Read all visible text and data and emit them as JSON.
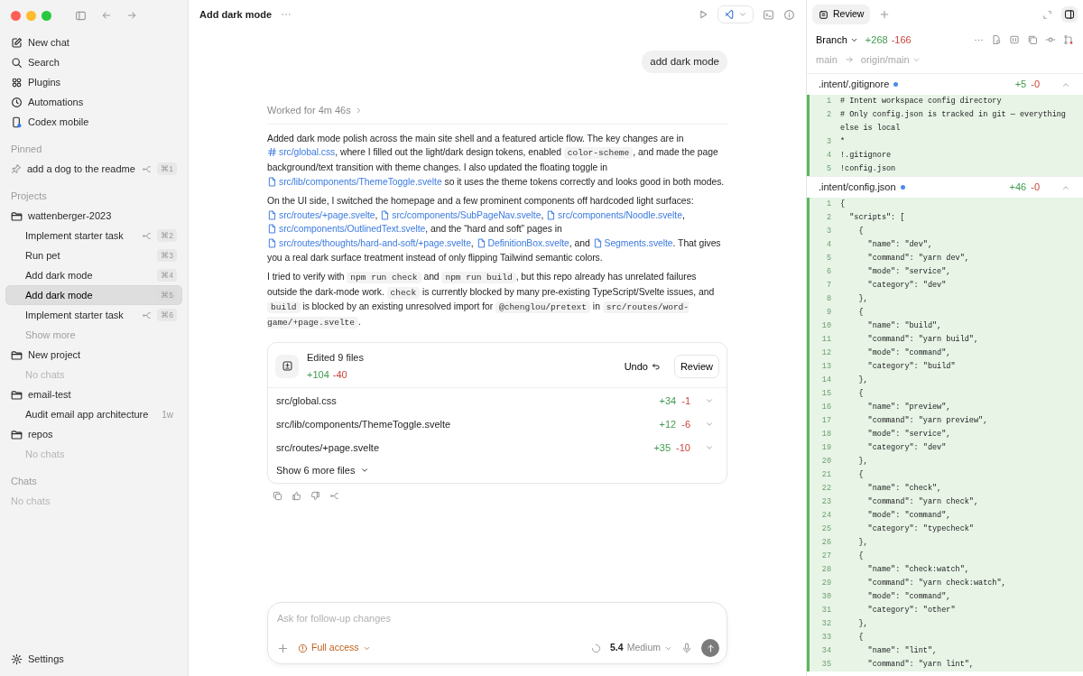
{
  "sidebar": {
    "nav": [
      {
        "label": "New chat"
      },
      {
        "label": "Search"
      },
      {
        "label": "Plugins"
      },
      {
        "label": "Automations"
      },
      {
        "label": "Codex mobile"
      }
    ],
    "pinned": {
      "heading": "Pinned",
      "chats": [
        {
          "title": "add a dog to the readme",
          "shortcut": "⌘1",
          "forked": true,
          "selected": false
        }
      ]
    },
    "projects": {
      "heading": "Projects",
      "items": [
        {
          "name": "wattenberger-2023",
          "chats": [
            {
              "title": "Implement starter task",
              "shortcut": "⌘2",
              "forked": true,
              "selected": false
            },
            {
              "title": "Run pet",
              "shortcut": "⌘3",
              "forked": false,
              "selected": false
            },
            {
              "title": "Add dark mode",
              "shortcut": "⌘4",
              "forked": false,
              "selected": false
            },
            {
              "title": "Add dark mode",
              "shortcut": "⌘5",
              "forked": false,
              "selected": true
            },
            {
              "title": "Implement starter task",
              "shortcut": "⌘6",
              "forked": true,
              "selected": false
            }
          ],
          "show_more": "Show more"
        },
        {
          "name": "New project",
          "empty_text": "No chats"
        },
        {
          "name": "email-test",
          "chats": [
            {
              "title": "Audit email app architecture",
              "age": "1w",
              "forked": false,
              "selected": false
            }
          ]
        },
        {
          "name": "repos",
          "empty_text": "No chats"
        }
      ]
    },
    "chats": {
      "heading": "Chats",
      "empty_text": "No chats"
    },
    "settings": "Settings"
  },
  "header": {
    "title": "Add dark mode"
  },
  "user_message": "add dark mode",
  "worked_for": "Worked for 4m 46s",
  "paragraphs": [
    [
      {
        "kind": "text",
        "text": "Added dark mode polish across the main site shell and a featured article flow. The key changes are in "
      },
      {
        "kind": "hash-link",
        "text": "src/global.css"
      },
      {
        "kind": "text",
        "text": ", where I filled out the light/dark design tokens, enabled "
      },
      {
        "kind": "code",
        "text": "color-scheme"
      },
      {
        "kind": "text",
        "text": ", and made the page background/text transition with theme changes. I also updated the floating toggle in "
      },
      {
        "kind": "file-link",
        "text": "src/lib/components/ThemeToggle.svelte"
      },
      {
        "kind": "text",
        "text": " so it uses the theme tokens correctly and looks good in both modes."
      }
    ],
    [
      {
        "kind": "text",
        "text": "On the UI side, I switched the homepage and a few prominent components off hardcoded light surfaces: "
      },
      {
        "kind": "file-link",
        "text": "src/routes/+page.svelte"
      },
      {
        "kind": "text",
        "text": ", "
      },
      {
        "kind": "file-link",
        "text": "src/components/SubPageNav.svelte"
      },
      {
        "kind": "text",
        "text": ", "
      },
      {
        "kind": "file-link",
        "text": "src/components/Noodle.svelte"
      },
      {
        "kind": "text",
        "text": ", "
      },
      {
        "kind": "file-link",
        "text": "src/components/OutlinedText.svelte"
      },
      {
        "kind": "text",
        "text": ", and the “hard and soft” pages in "
      },
      {
        "kind": "file-link",
        "text": "src/routes/thoughts/hard-and-soft/+page.svelte"
      },
      {
        "kind": "text",
        "text": ", "
      },
      {
        "kind": "file-link",
        "text": "DefinitionBox.svelte"
      },
      {
        "kind": "text",
        "text": ", and "
      },
      {
        "kind": "file-link",
        "text": "Segments.svelte"
      },
      {
        "kind": "text",
        "text": ". That gives you a real dark surface treatment instead of only flipping Tailwind semantic colors."
      }
    ],
    [
      {
        "kind": "text",
        "text": "I tried to verify with "
      },
      {
        "kind": "code",
        "text": "npm run check"
      },
      {
        "kind": "text",
        "text": " and "
      },
      {
        "kind": "code",
        "text": "npm run build"
      },
      {
        "kind": "text",
        "text": ", but this repo already has unrelated failures outside the dark-mode work. "
      },
      {
        "kind": "code",
        "text": "check"
      },
      {
        "kind": "text",
        "text": " is currently blocked by many pre-existing TypeScript/Svelte issues, and "
      },
      {
        "kind": "code",
        "text": "build"
      },
      {
        "kind": "text",
        "text": " is blocked by an existing unresolved import for "
      },
      {
        "kind": "code",
        "text": "@chenglou/pretext"
      },
      {
        "kind": "text",
        "text": " in "
      },
      {
        "kind": "code",
        "text": "src/routes/word-game/+page.svelte"
      },
      {
        "kind": "text",
        "text": "."
      }
    ]
  ],
  "edits": {
    "title": "Edited 9 files",
    "added": "+104",
    "removed": "-40",
    "undo": "Undo",
    "review": "Review",
    "files": [
      {
        "path": "src/global.css",
        "added": "+34",
        "removed": "-1"
      },
      {
        "path": "src/lib/components/ThemeToggle.svelte",
        "added": "+12",
        "removed": "-6"
      },
      {
        "path": "src/routes/+page.svelte",
        "added": "+35",
        "removed": "-10"
      }
    ],
    "show_more": "Show 6 more files"
  },
  "composer": {
    "placeholder": "Ask for follow-up changes",
    "access": "Full access",
    "model": "5.4",
    "effort": "Medium"
  },
  "review_panel": {
    "tabs": [
      {
        "label": "Review",
        "selected": true
      }
    ],
    "branch": "Branch",
    "added": "+268",
    "removed": "-166",
    "base": "main",
    "target": "origin/main",
    "files": [
      {
        "name": ".intent/.gitignore",
        "changed": true,
        "added": "+5",
        "removed": "-0",
        "lines": [
          {
            "n": "1",
            "text": "# Intent workspace config directory"
          },
          {
            "n": "2",
            "text": "# Only config.json is tracked in git — everything else is local"
          },
          {
            "n": "3",
            "text": "*"
          },
          {
            "n": "4",
            "text": "!.gitignore"
          },
          {
            "n": "5",
            "text": "!config.json"
          }
        ]
      },
      {
        "name": ".intent/config.json",
        "changed": true,
        "added": "+46",
        "removed": "-0",
        "lines": [
          {
            "n": "1",
            "text": "{"
          },
          {
            "n": "2",
            "text": "  \"scripts\": ["
          },
          {
            "n": "3",
            "text": "    {"
          },
          {
            "n": "4",
            "text": "      \"name\": \"dev\","
          },
          {
            "n": "5",
            "text": "      \"command\": \"yarn dev\","
          },
          {
            "n": "6",
            "text": "      \"mode\": \"service\","
          },
          {
            "n": "7",
            "text": "      \"category\": \"dev\""
          },
          {
            "n": "8",
            "text": "    },"
          },
          {
            "n": "9",
            "text": "    {"
          },
          {
            "n": "10",
            "text": "      \"name\": \"build\","
          },
          {
            "n": "11",
            "text": "      \"command\": \"yarn build\","
          },
          {
            "n": "12",
            "text": "      \"mode\": \"command\","
          },
          {
            "n": "13",
            "text": "      \"category\": \"build\""
          },
          {
            "n": "14",
            "text": "    },"
          },
          {
            "n": "15",
            "text": "    {"
          },
          {
            "n": "16",
            "text": "      \"name\": \"preview\","
          },
          {
            "n": "17",
            "text": "      \"command\": \"yarn preview\","
          },
          {
            "n": "18",
            "text": "      \"mode\": \"service\","
          },
          {
            "n": "19",
            "text": "      \"category\": \"dev\""
          },
          {
            "n": "20",
            "text": "    },"
          },
          {
            "n": "21",
            "text": "    {"
          },
          {
            "n": "22",
            "text": "      \"name\": \"check\","
          },
          {
            "n": "23",
            "text": "      \"command\": \"yarn check\","
          },
          {
            "n": "24",
            "text": "      \"mode\": \"command\","
          },
          {
            "n": "25",
            "text": "      \"category\": \"typecheck\""
          },
          {
            "n": "26",
            "text": "    },"
          },
          {
            "n": "27",
            "text": "    {"
          },
          {
            "n": "28",
            "text": "      \"name\": \"check:watch\","
          },
          {
            "n": "29",
            "text": "      \"command\": \"yarn check:watch\","
          },
          {
            "n": "30",
            "text": "      \"mode\": \"command\","
          },
          {
            "n": "31",
            "text": "      \"category\": \"other\""
          },
          {
            "n": "32",
            "text": "    },"
          },
          {
            "n": "33",
            "text": "    {"
          },
          {
            "n": "34",
            "text": "      \"name\": \"lint\","
          },
          {
            "n": "35",
            "text": "      \"command\": \"yarn lint\","
          }
        ]
      }
    ]
  }
}
